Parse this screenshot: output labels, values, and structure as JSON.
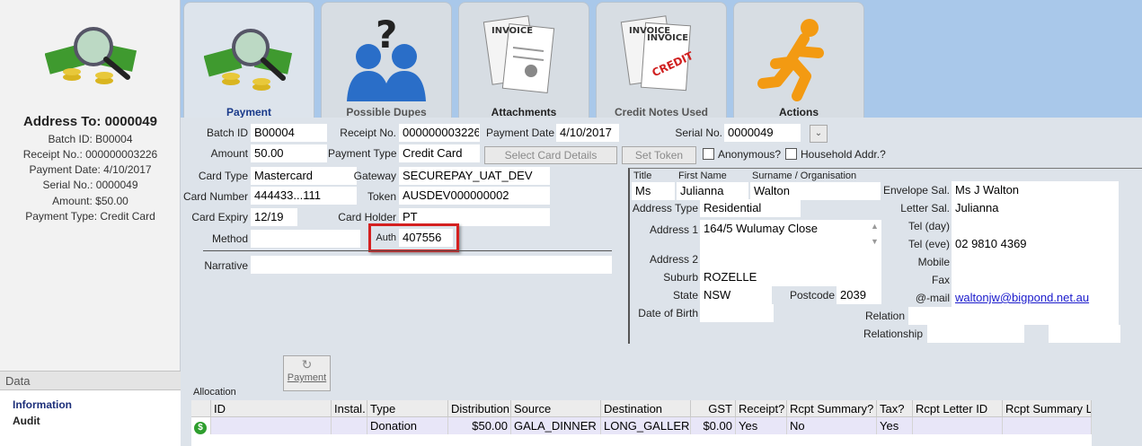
{
  "left": {
    "title": "Address To: 0000049",
    "lines": [
      "Batch ID: B00004",
      "Receipt No.: 000000003226",
      "Payment Date: 4/10/2017",
      "Serial No.: 0000049",
      "Amount: $50.00",
      "Payment Type: Credit Card"
    ],
    "data_header": "Data",
    "data_items": [
      "Information",
      "Audit"
    ],
    "icon": "payment-money-magnifier-icon"
  },
  "tabs": [
    {
      "label": "Payment",
      "icon": "payment-money-magnifier-icon",
      "active": true
    },
    {
      "label": "Possible Dupes",
      "icon": "people-question-icon",
      "active": false
    },
    {
      "label": "Attachments",
      "icon": "invoice-pin-icon",
      "active": false
    },
    {
      "label": "Credit Notes Used",
      "icon": "invoice-credit-icon",
      "active": false
    },
    {
      "label": "Actions",
      "icon": "running-man-icon",
      "active": false
    }
  ],
  "form": {
    "batch_id_label": "Batch ID",
    "batch_id": "B00004",
    "receipt_label": "Receipt No.",
    "receipt": "000000003226",
    "payment_date_label": "Payment Date",
    "payment_date": "4/10/2017",
    "serial_label": "Serial No.",
    "serial": "0000049",
    "amount_label": "Amount",
    "amount": "50.00",
    "payment_type_label": "Payment Type",
    "payment_type": "Credit Card",
    "select_card_btn": "Select Card Details",
    "set_token_btn": "Set Token",
    "anonymous_label": "Anonymous?",
    "household_label": "Household Addr.?",
    "card_type_label": "Card Type",
    "card_type": "Mastercard",
    "gateway_label": "Gateway",
    "gateway": "SECUREPAY_UAT_DEV",
    "card_number_label": "Card Number",
    "card_number": "444433...111",
    "token_label": "Token",
    "token": "AUSDEV000000002",
    "card_expiry_label": "Card Expiry",
    "card_expiry": "12/19",
    "card_holder_label": "Card Holder",
    "card_holder": "PT",
    "method_label": "Method",
    "method": "",
    "auth_label": "Auth",
    "auth": "407556",
    "narrative_label": "Narrative",
    "narrative": ""
  },
  "address": {
    "title_label": "Title",
    "title": "Ms",
    "first_name_label": "First Name",
    "first_name": "Julianna",
    "surname_label": "Surname / Organisation",
    "surname": "Walton",
    "address_type_label": "Address Type",
    "address_type": "Residential",
    "address1_label": "Address 1",
    "address1": "164/5 Wulumay Close",
    "address2_label": "Address 2",
    "address2": "",
    "suburb_label": "Suburb",
    "suburb": "ROZELLE",
    "state_label": "State",
    "state": "NSW",
    "postcode_label": "Postcode",
    "postcode": "2039",
    "dob_label": "Date of Birth",
    "dob": "",
    "envelope_label": "Envelope Sal.",
    "envelope": "Ms J Walton",
    "letter_label": "Letter Sal.",
    "letter": "Julianna",
    "tel_day_label": "Tel (day)",
    "tel_day": "",
    "tel_eve_label": "Tel (eve)",
    "tel_eve": "02 9810 4369",
    "mobile_label": "Mobile",
    "mobile": "",
    "fax_label": "Fax",
    "fax": "",
    "email_label": "@-mail",
    "email": "waltonjw@bigpond.net.au",
    "relation_label": "Relation",
    "relation": "",
    "relationship_label": "Relationship",
    "relationship": ""
  },
  "payment_button": "Payment",
  "allocation": {
    "label": "Allocation",
    "headers": [
      "ID",
      "Instal.",
      "Type",
      "Distribution",
      "Source",
      "Destination",
      "GST",
      "Receipt?",
      "Rcpt Summary?",
      "Tax?",
      "Rcpt Letter ID",
      "Rcpt Summary L"
    ],
    "rows": [
      {
        "id": "",
        "instal": "",
        "type": "Donation",
        "distribution": "$50.00",
        "source": "GALA_DINNER",
        "destination": "LONG_GALLER",
        "gst": "$0.00",
        "receipt": "Yes",
        "rcpt_summary": "No",
        "tax": "Yes",
        "rcpt_letter_id": "",
        "rcpt_summary_l": ""
      }
    ]
  },
  "colors": {
    "tab_bar": "#a9c8ea",
    "highlight": "#d42020",
    "row": "#e8e6f8",
    "link": "#1a1acc",
    "active_tab": "#1a3a8a"
  }
}
